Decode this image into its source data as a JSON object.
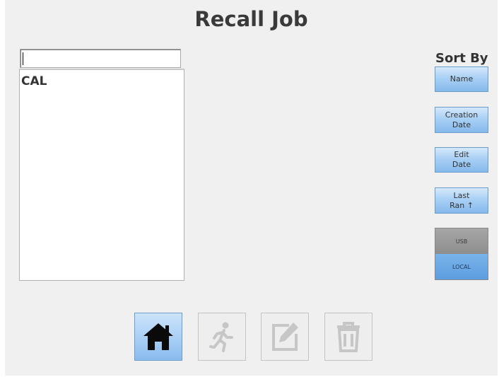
{
  "title": "Recall Job",
  "search": {
    "value": "",
    "placeholder": ""
  },
  "job_list": {
    "items": [
      "CAL"
    ]
  },
  "sort": {
    "heading": "Sort By",
    "buttons": [
      {
        "label": "Name"
      },
      {
        "label": "Creation\nDate"
      },
      {
        "label": "Edit\nDate"
      },
      {
        "label": "Last\nRan ↑"
      }
    ]
  },
  "storage": {
    "usb_label": "USB",
    "local_label": "LOCAL",
    "selected": "LOCAL"
  },
  "toolbar": [
    {
      "icon": "home-icon",
      "enabled": true
    },
    {
      "icon": "run-icon",
      "enabled": false
    },
    {
      "icon": "edit-icon",
      "enabled": false
    },
    {
      "icon": "trash-icon",
      "enabled": false
    }
  ],
  "colors": {
    "accent": "#8bbcee",
    "disabled": "#c8c8c8",
    "panel": "#f0f0f0"
  }
}
